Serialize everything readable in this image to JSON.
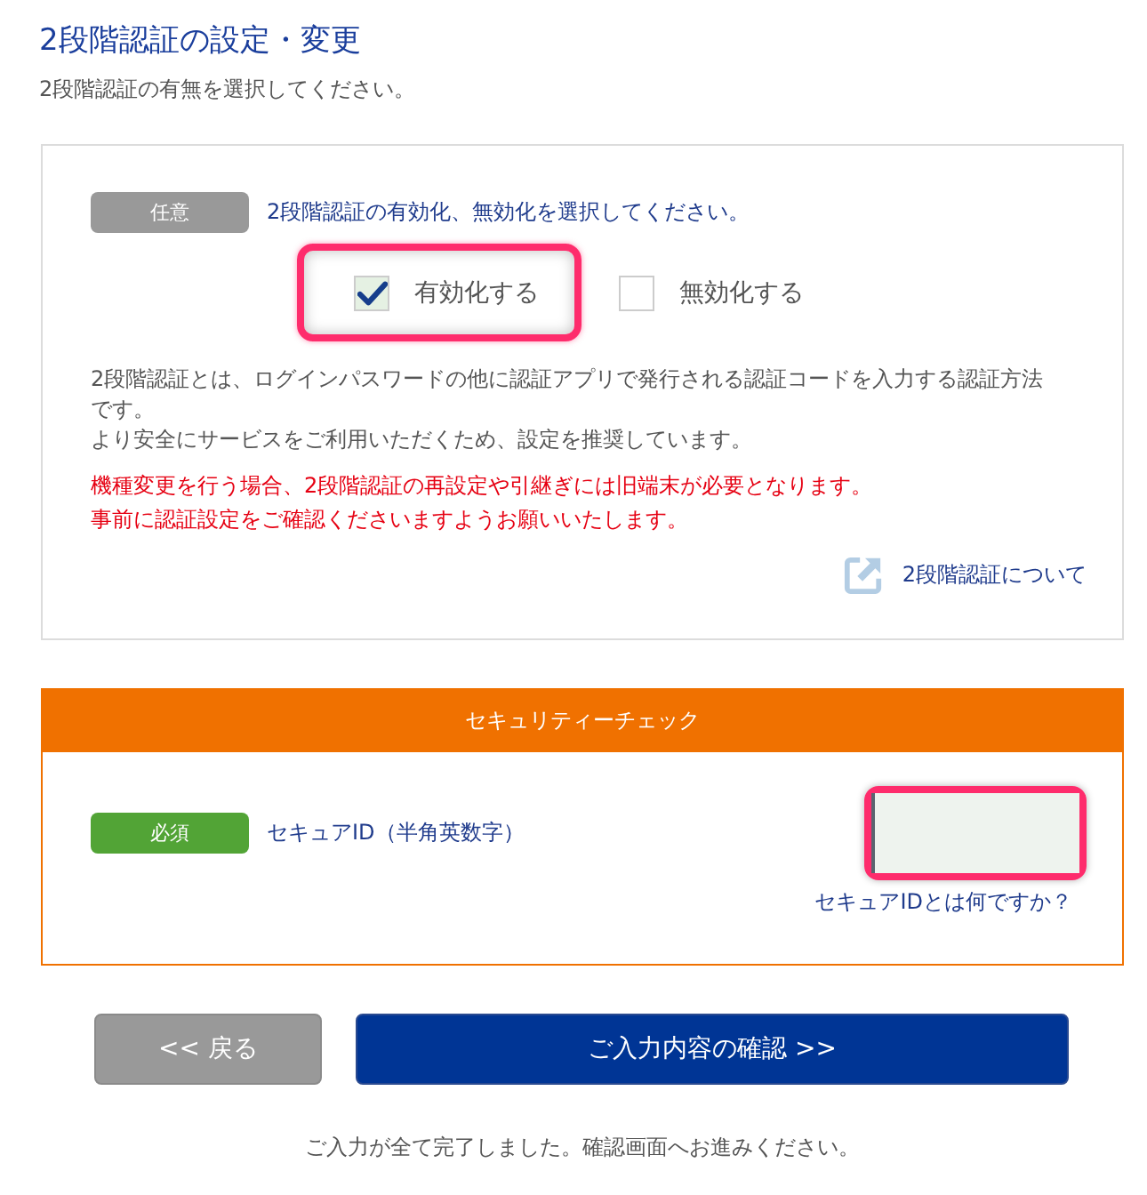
{
  "page": {
    "title": "2段階認証の設定・変更",
    "subtitle": "2段階認証の有無を選択してください。"
  },
  "two_factor": {
    "badge": "任意",
    "prompt": "2段階認証の有効化、無効化を選択してください。",
    "options": [
      {
        "label": "有効化する",
        "checked": true,
        "highlighted": true
      },
      {
        "label": "無効化する",
        "checked": false,
        "highlighted": false
      }
    ],
    "description": [
      "2段階認証とは、ログインパスワードの他に認証アプリで発行される認証コードを入力する認証方法です。",
      "より安全にサービスをご利用いただくため、設定を推奨しています。"
    ],
    "warning": [
      "機種変更を行う場合、2段階認証の再設定や引継ぎには旧端末が必要となります。",
      "事前に認証設定をご確認くださいますようお願いいたします。"
    ],
    "link": "2段階認証について"
  },
  "security_check": {
    "header": "セキュリティーチェック",
    "badge": "必須",
    "field_label": "セキュアID（半角英数字）",
    "field_highlighted": true,
    "help_link": "セキュアIDとは何ですか？"
  },
  "buttons": [
    {
      "label": "<< 戻る",
      "kind": "back"
    },
    {
      "label": "ご入力内容の確認 >>",
      "kind": "primary"
    }
  ],
  "footer": "ご入力が全て完了しました。確認画面へお進みください。"
}
